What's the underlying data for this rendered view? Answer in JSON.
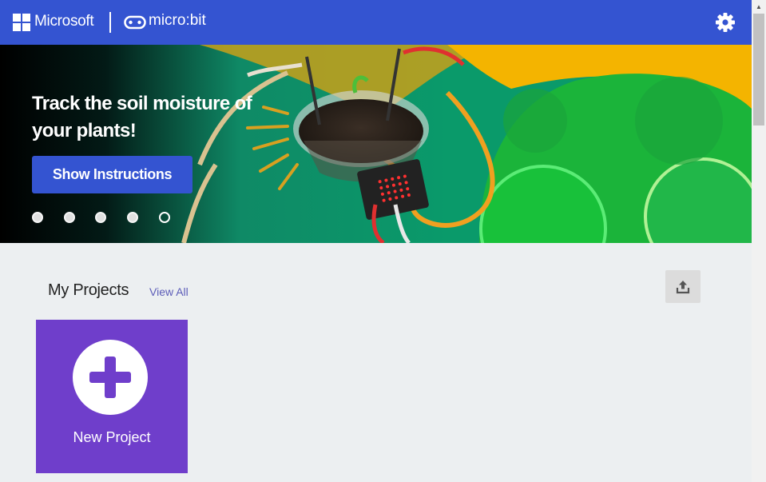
{
  "header": {
    "brand": "Microsoft",
    "product": "micro:bit",
    "settings_icon": "gear-icon"
  },
  "hero": {
    "title": "Track the soil moisture of your plants!",
    "button_label": "Show Instructions",
    "slides": {
      "count": 5,
      "active_index": 4
    }
  },
  "projects": {
    "title": "My Projects",
    "view_all": "View All",
    "import_icon": "upload-icon",
    "new_project_label": "New Project"
  },
  "colors": {
    "header_bg": "#3454d1",
    "button_bg": "#3454d1",
    "card_bg": "#6f3ecb",
    "link": "#5c5cb8",
    "page_bg": "#eceff1"
  }
}
